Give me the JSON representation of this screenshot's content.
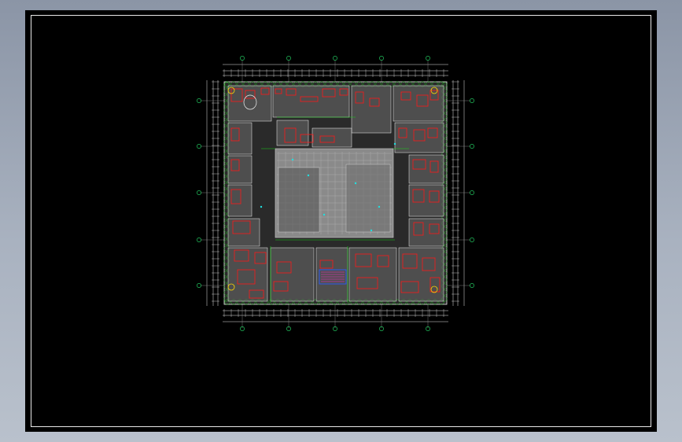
{
  "app": {
    "title": ""
  },
  "drawing": {
    "kind": "cad-floor-plan",
    "background": "#000000",
    "frame_color": "#e8e8e8",
    "colors": {
      "dimension": "#e6e6e6",
      "gridline": "#9a9a9a",
      "grid_bubble": "#22c55e",
      "furniture": "#ff1a1a",
      "wall": "#f2f2f2",
      "fill_gray": "#6b6b6b",
      "court": "#8a8a8a",
      "accent_green": "#16d616",
      "accent_blue": "#2b5cff",
      "accent_yellow": "#ffd700",
      "accent_magenta": "#ff2bd6",
      "accent_cyan": "#20e0e0"
    },
    "labels": {
      "top_overall_dim": "",
      "bottom_overall_dim": ""
    }
  }
}
